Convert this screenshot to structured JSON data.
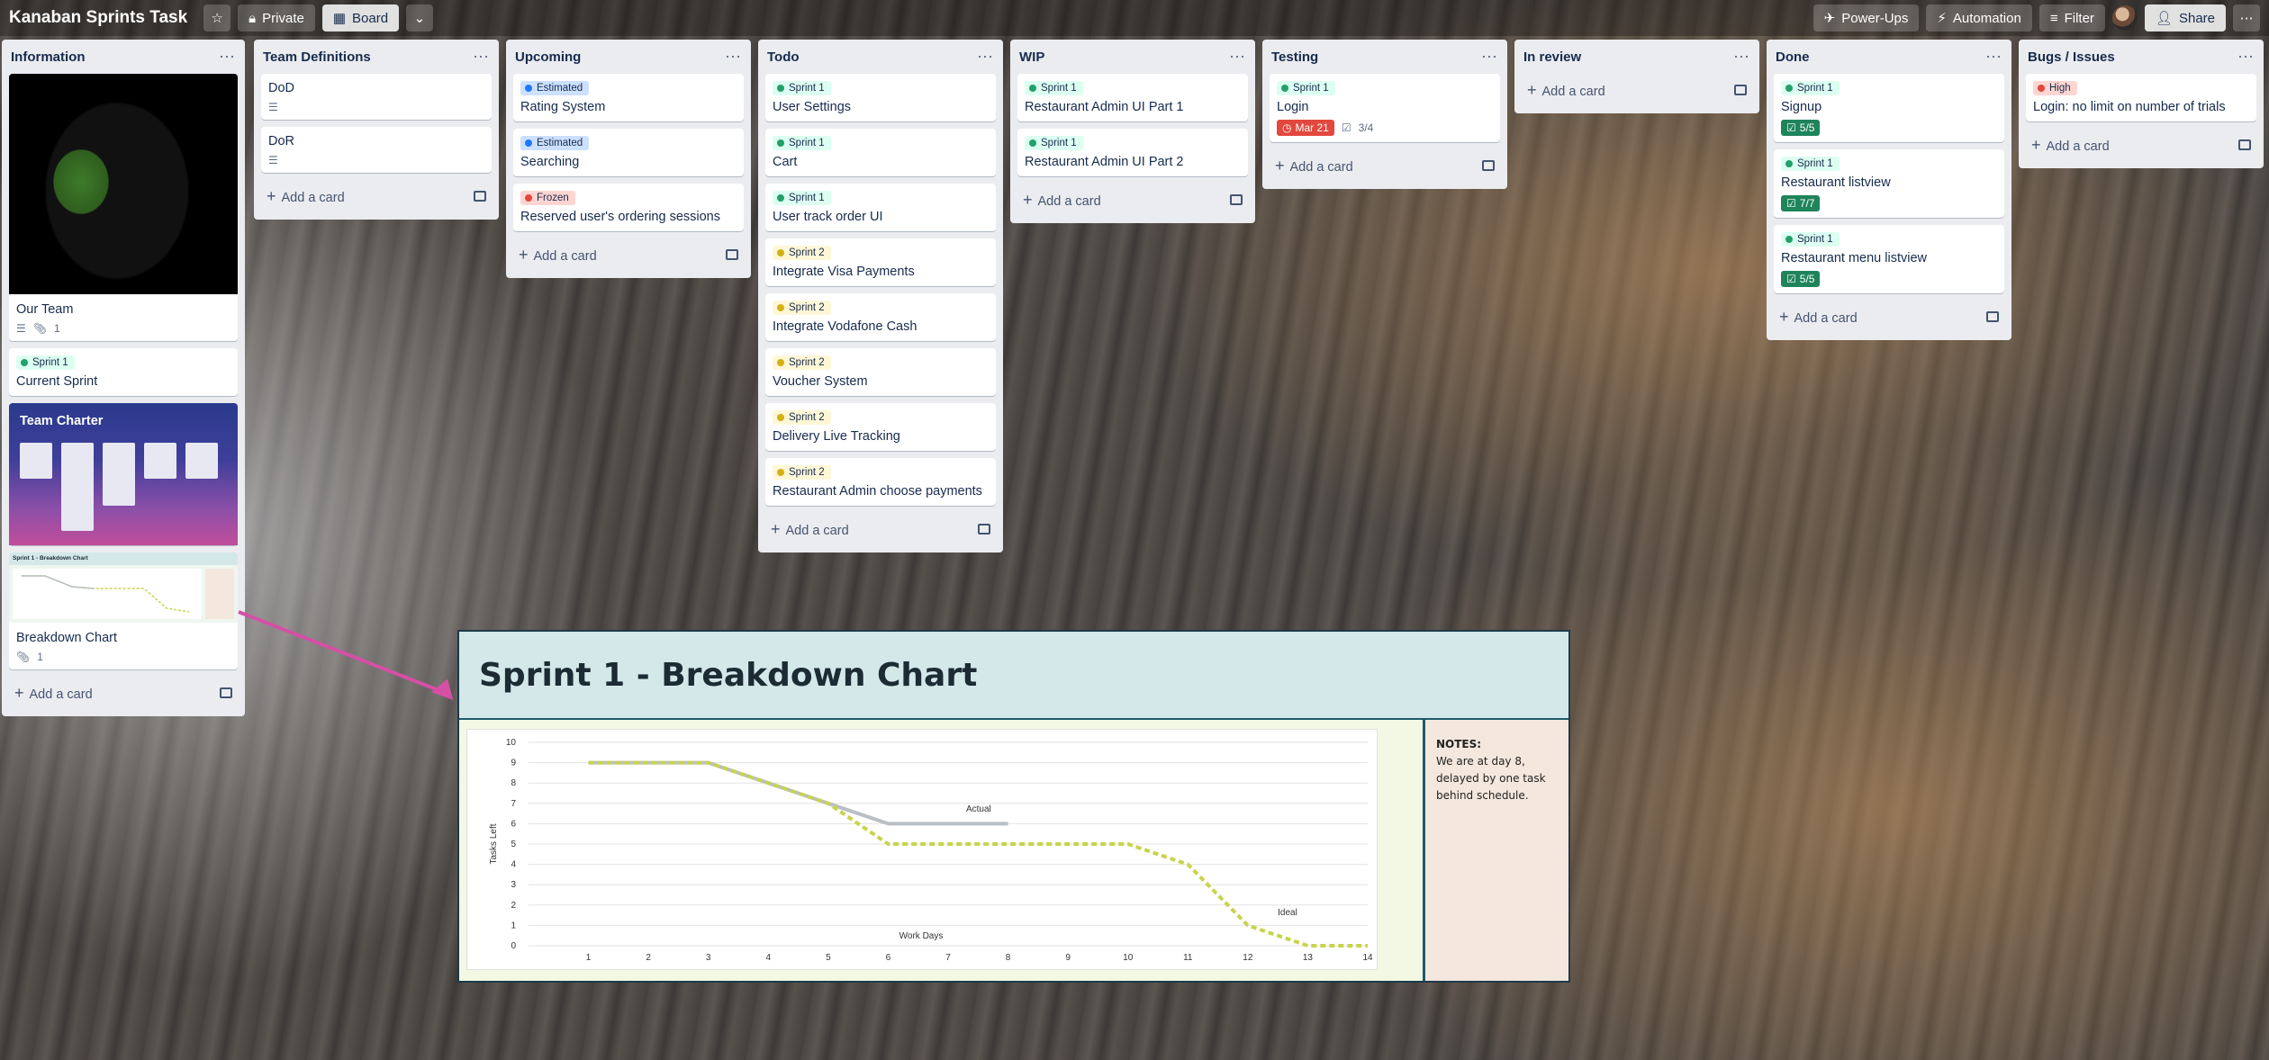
{
  "topbar": {
    "board_title": "Kanaban Sprints Task",
    "visibility": "Private",
    "view": "Board",
    "powerups": "Power-Ups",
    "automation": "Automation",
    "filter": "Filter",
    "share": "Share"
  },
  "common": {
    "add_card": "Add a card"
  },
  "lists": {
    "information": {
      "title": "Information",
      "cards": [
        {
          "title": "Our Team",
          "attachments": "1"
        },
        {
          "label": "Sprint 1",
          "title": "Current Sprint"
        },
        {
          "cover_title": "Team Charter"
        },
        {
          "cover_caption": "Sprint 1 - Breakdown Chart",
          "title": "Breakdown Chart",
          "attachments": "1"
        }
      ]
    },
    "team_definitions": {
      "title": "Team Definitions",
      "cards": [
        {
          "title": "DoD"
        },
        {
          "title": "DoR"
        }
      ]
    },
    "upcoming": {
      "title": "Upcoming",
      "cards": [
        {
          "label": "Estimated",
          "title": "Rating System"
        },
        {
          "label": "Estimated",
          "title": "Searching"
        },
        {
          "label": "Frozen",
          "title": "Reserved user's ordering sessions"
        }
      ]
    },
    "todo": {
      "title": "Todo",
      "cards": [
        {
          "label": "Sprint 1",
          "title": "User Settings"
        },
        {
          "label": "Sprint 1",
          "title": "Cart"
        },
        {
          "label": "Sprint 1",
          "title": "User track order UI"
        },
        {
          "label": "Sprint 2",
          "title": "Integrate Visa Payments"
        },
        {
          "label": "Sprint 2",
          "title": "Integrate Vodafone Cash"
        },
        {
          "label": "Sprint 2",
          "title": "Voucher System"
        },
        {
          "label": "Sprint 2",
          "title": "Delivery Live Tracking"
        },
        {
          "label": "Sprint 2",
          "title": "Restaurant Admin choose payments"
        }
      ]
    },
    "wip": {
      "title": "WIP",
      "cards": [
        {
          "label": "Sprint 1",
          "title": "Restaurant Admin UI Part 1"
        },
        {
          "label": "Sprint 1",
          "title": "Restaurant Admin UI Part 2"
        }
      ]
    },
    "testing": {
      "title": "Testing",
      "cards": [
        {
          "label": "Sprint 1",
          "title": "Login",
          "due": "Mar 21",
          "checklist": "3/4"
        }
      ]
    },
    "in_review": {
      "title": "In review"
    },
    "done": {
      "title": "Done",
      "cards": [
        {
          "label": "Sprint 1",
          "title": "Signup",
          "checklist": "5/5"
        },
        {
          "label": "Sprint 1",
          "title": "Restaurant listview",
          "checklist": "7/7"
        },
        {
          "label": "Sprint 1",
          "title": "Restaurant menu listview",
          "checklist": "5/5"
        }
      ]
    },
    "bugs": {
      "title": "Bugs / Issues",
      "cards": [
        {
          "label": "High",
          "title": "Login: no limit on number of trials"
        }
      ]
    }
  },
  "chart_panel": {
    "title": "Sprint 1 - Breakdown Chart",
    "notes_heading": "NOTES:",
    "notes_text": "We are at day 8, delayed by one task behind schedule."
  },
  "chart_data": {
    "type": "line",
    "title": "",
    "xlabel": "Work Days",
    "ylabel": "Tasks Left",
    "x": [
      1,
      2,
      3,
      4,
      5,
      6,
      7,
      8,
      9,
      10,
      11,
      12,
      13,
      14
    ],
    "xlim": [
      0,
      14
    ],
    "ylim": [
      0,
      10
    ],
    "yticks": [
      0,
      1,
      2,
      3,
      4,
      5,
      6,
      7,
      8,
      9,
      10
    ],
    "grid": true,
    "series": [
      {
        "name": "Actual",
        "color": "#b9bfc4",
        "x": [
          1,
          2,
          3,
          4,
          5,
          6,
          7,
          8
        ],
        "values": [
          9,
          9,
          9,
          8,
          7,
          6,
          6,
          6
        ]
      },
      {
        "name": "Ideal",
        "color": "#c8d44a",
        "x": [
          1,
          2,
          3,
          4,
          5,
          6,
          7,
          8,
          9,
          10,
          11,
          12,
          13,
          14
        ],
        "values": [
          9,
          9,
          9,
          8,
          7,
          5,
          5,
          5,
          5,
          5,
          4,
          1,
          0,
          0
        ]
      }
    ]
  }
}
